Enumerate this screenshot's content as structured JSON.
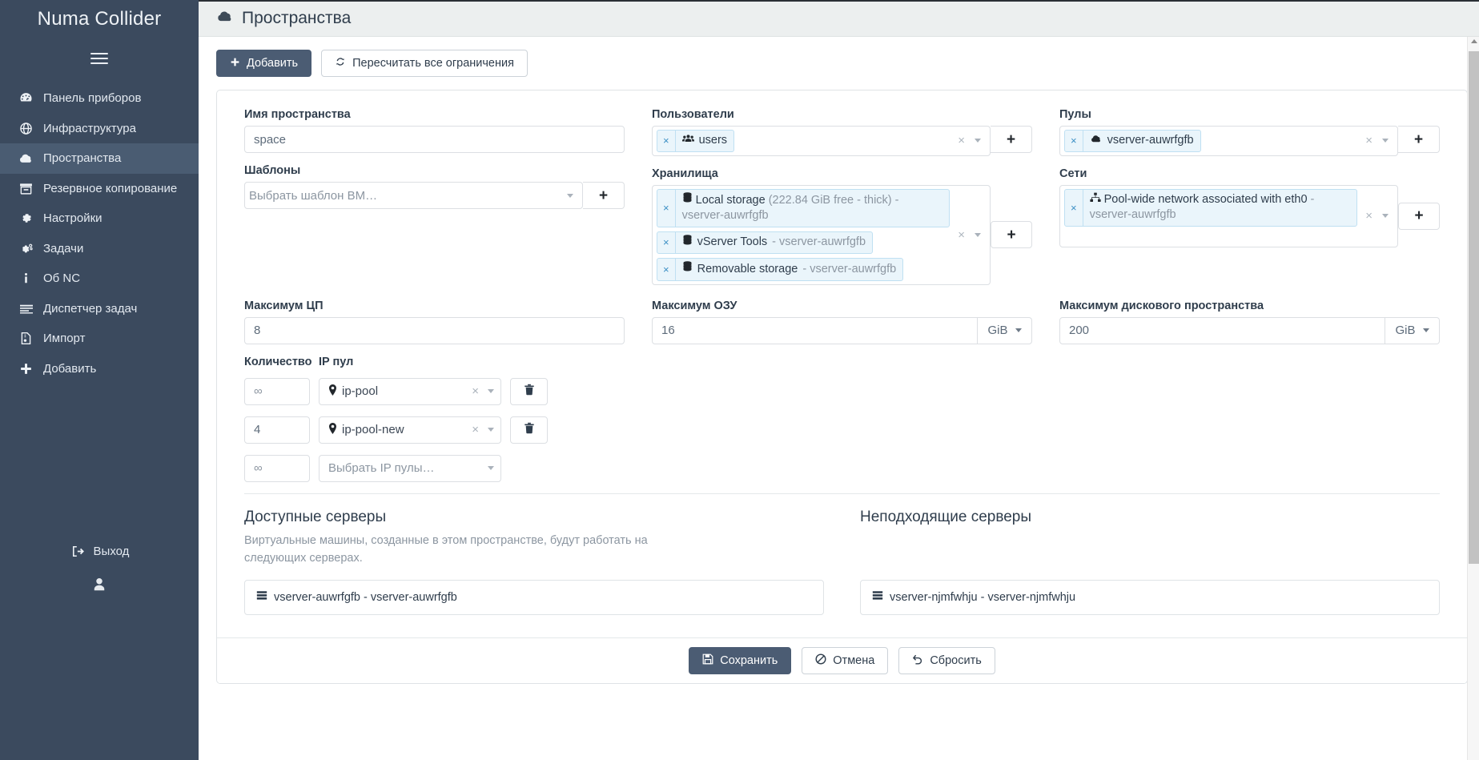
{
  "sidebar": {
    "brand": "Numa Collider",
    "menu_icon": "hamburger-icon",
    "items": [
      {
        "label": "Панель приборов",
        "icon": "dashboard-icon",
        "active": false
      },
      {
        "label": "Инфраструктура",
        "icon": "globe-icon",
        "active": false
      },
      {
        "label": "Пространства",
        "icon": "cloud-icon",
        "active": true
      },
      {
        "label": "Резервное копирование",
        "icon": "archive-icon",
        "active": false
      },
      {
        "label": "Настройки",
        "icon": "gear-icon",
        "active": false
      },
      {
        "label": "Задачи",
        "icon": "gears-icon",
        "active": false
      },
      {
        "label": "Об NC",
        "icon": "info-icon",
        "active": false
      },
      {
        "label": "Диспетчер задач",
        "icon": "tasklist-icon",
        "active": false
      },
      {
        "label": "Импорт",
        "icon": "import-file-icon",
        "active": false
      },
      {
        "label": "Добавить",
        "icon": "plus-icon",
        "active": false
      }
    ],
    "logout_label": "Выход",
    "logout_icon": "sign-out-icon",
    "avatar_icon": "user-icon"
  },
  "header": {
    "title": "Пространства",
    "icon": "cloud-icon"
  },
  "toolbar": {
    "add_label": "Добавить",
    "add_icon": "plus-icon",
    "recalc_label": "Пересчитать все ограничения",
    "recalc_icon": "refresh-icon"
  },
  "form": {
    "space_name": {
      "label": "Имя пространства",
      "value": "space"
    },
    "templates": {
      "label": "Шаблоны",
      "placeholder": "Выбрать шаблон ВМ…",
      "value": ""
    },
    "users": {
      "label": "Пользователи",
      "tags": [
        {
          "icon": "users-icon",
          "name": "users",
          "suffix": ""
        }
      ]
    },
    "storages": {
      "label": "Хранилища",
      "tags": [
        {
          "icon": "database-icon",
          "name": "Local storage",
          "detail": "(222.84 GiB free - thick) - vserver-auwrfgfb"
        },
        {
          "icon": "database-icon",
          "name": "vServer Tools",
          "detail": "- vserver-auwrfgfb"
        },
        {
          "icon": "database-icon",
          "name": "Removable storage",
          "detail": "- vserver-auwrfgfb"
        }
      ]
    },
    "pools": {
      "label": "Пулы",
      "tags": [
        {
          "icon": "cloud-icon",
          "name": "vserver-auwrfgfb",
          "detail": ""
        }
      ]
    },
    "networks": {
      "label": "Сети",
      "tags": [
        {
          "icon": "network-icon",
          "name": "Pool-wide network associated with eth0",
          "detail": "- vserver-auwrfgfb"
        }
      ]
    },
    "max_cpu": {
      "label": "Максимум ЦП",
      "value": "8"
    },
    "max_ram": {
      "label": "Максимум ОЗУ",
      "value": "16",
      "unit": "GiB"
    },
    "max_disk": {
      "label": "Максимум дискового пространства",
      "value": "200",
      "unit": "GiB"
    },
    "ip_pools": {
      "qty_label": "Количество",
      "pool_label": "IP пул",
      "placeholder": "Выбрать IP пулы…",
      "rows": [
        {
          "qty": "∞",
          "pool": "ip-pool",
          "has_pool": true,
          "has_delete": true
        },
        {
          "qty": "4",
          "pool": "ip-pool-new",
          "has_pool": true,
          "has_delete": true
        },
        {
          "qty": "∞",
          "pool": "Выбрать IP пулы…",
          "has_pool": false,
          "has_delete": false
        }
      ],
      "delete_icon": "trash-icon",
      "location_icon": "map-marker-icon"
    }
  },
  "servers": {
    "available": {
      "title": "Доступные серверы",
      "description": "Виртуальные машины, созданные в этом пространстве, будут работать на следующих серверах.",
      "items": [
        {
          "icon": "server-icon",
          "label": "vserver-auwrfgfb - vserver-auwrfgfb"
        }
      ]
    },
    "unsuitable": {
      "title": "Неподходящие серверы",
      "description": "",
      "items": [
        {
          "icon": "server-icon",
          "label": "vserver-njmfwhju - vserver-njmfwhju"
        }
      ]
    }
  },
  "footer": {
    "save_label": "Сохранить",
    "save_icon": "save-icon",
    "cancel_label": "Отмена",
    "cancel_icon": "ban-icon",
    "reset_label": "Сбросить",
    "reset_icon": "undo-icon"
  },
  "colors": {
    "sidebar_bg": "#3b4a5e",
    "sidebar_active": "#4a5c72",
    "primary": "#4b5c73",
    "topbar_bg": "#ecefef",
    "tag_bg": "#eaf5fb",
    "tag_border": "#bfe0f2",
    "muted_text": "#8c96a1"
  }
}
